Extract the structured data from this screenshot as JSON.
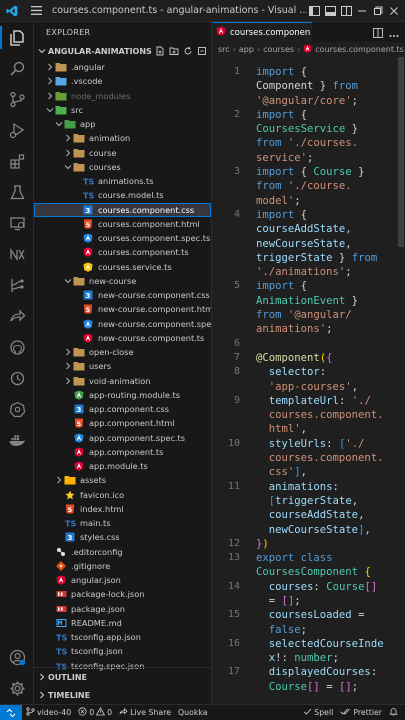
{
  "window": {
    "title": "courses.component.ts - angular-animations - Visual …"
  },
  "sidebar": {
    "header": "EXPLORER",
    "root": "ANGULAR-ANIMATIONS",
    "tree": [
      {
        "label": ".angular",
        "depth": 1,
        "kind": "folder",
        "open": false,
        "icon": "folder",
        "color": "#cccccc"
      },
      {
        "label": ".vscode",
        "depth": 1,
        "kind": "folder",
        "open": false,
        "icon": "vscode-folder",
        "color": "#cccccc"
      },
      {
        "label": "node_modules",
        "depth": 1,
        "kind": "folder",
        "open": false,
        "icon": "node-folder",
        "color": "#6b6b6b"
      },
      {
        "label": "src",
        "depth": 1,
        "kind": "folder",
        "open": true,
        "icon": "src-folder",
        "color": "#cccccc"
      },
      {
        "label": "app",
        "depth": 2,
        "kind": "folder",
        "open": true,
        "icon": "app-folder",
        "color": "#cccccc"
      },
      {
        "label": "animation",
        "depth": 3,
        "kind": "folder",
        "open": false,
        "icon": "folder",
        "color": "#cccccc"
      },
      {
        "label": "course",
        "depth": 3,
        "kind": "folder",
        "open": false,
        "icon": "folder",
        "color": "#cccccc"
      },
      {
        "label": "courses",
        "depth": 3,
        "kind": "folder",
        "open": true,
        "icon": "folder",
        "color": "#cccccc"
      },
      {
        "label": "animations.ts",
        "depth": 4,
        "kind": "file",
        "icon": "ts",
        "color": "#cccccc"
      },
      {
        "label": "course.model.ts",
        "depth": 4,
        "kind": "file",
        "icon": "ts",
        "color": "#cccccc"
      },
      {
        "label": "courses.component.css",
        "depth": 4,
        "kind": "file",
        "icon": "css",
        "color": "#ffffff",
        "selected": true
      },
      {
        "label": "courses.component.html",
        "depth": 4,
        "kind": "file",
        "icon": "html",
        "color": "#cccccc"
      },
      {
        "label": "courses.component.spec.ts",
        "depth": 4,
        "kind": "file",
        "icon": "angular-spec",
        "color": "#cccccc"
      },
      {
        "label": "courses.component.ts",
        "depth": 4,
        "kind": "file",
        "icon": "angular",
        "color": "#cccccc"
      },
      {
        "label": "courses.service.ts",
        "depth": 4,
        "kind": "file",
        "icon": "angular-service",
        "color": "#cccccc"
      },
      {
        "label": "new-course",
        "depth": 3,
        "kind": "folder",
        "open": true,
        "icon": "folder",
        "color": "#cccccc"
      },
      {
        "label": "new-course.component.css",
        "depth": 4,
        "kind": "file",
        "icon": "css",
        "color": "#cccccc"
      },
      {
        "label": "new-course.component.html",
        "depth": 4,
        "kind": "file",
        "icon": "html",
        "color": "#cccccc"
      },
      {
        "label": "new-course.component.spec.ts",
        "depth": 4,
        "kind": "file",
        "icon": "angular-spec",
        "color": "#cccccc"
      },
      {
        "label": "new-course.component.ts",
        "depth": 4,
        "kind": "file",
        "icon": "angular",
        "color": "#cccccc"
      },
      {
        "label": "open-close",
        "depth": 3,
        "kind": "folder",
        "open": false,
        "icon": "folder",
        "color": "#cccccc"
      },
      {
        "label": "users",
        "depth": 3,
        "kind": "folder",
        "open": false,
        "icon": "folder",
        "color": "#cccccc"
      },
      {
        "label": "void-animation",
        "depth": 3,
        "kind": "folder",
        "open": false,
        "icon": "folder",
        "color": "#cccccc"
      },
      {
        "label": "app-routing.module.ts",
        "depth": 3,
        "kind": "file",
        "icon": "angular-routing",
        "color": "#cccccc"
      },
      {
        "label": "app.component.css",
        "depth": 3,
        "kind": "file",
        "icon": "css",
        "color": "#cccccc"
      },
      {
        "label": "app.component.html",
        "depth": 3,
        "kind": "file",
        "icon": "html",
        "color": "#cccccc"
      },
      {
        "label": "app.component.spec.ts",
        "depth": 3,
        "kind": "file",
        "icon": "angular-spec",
        "color": "#cccccc"
      },
      {
        "label": "app.component.ts",
        "depth": 3,
        "kind": "file",
        "icon": "angular",
        "color": "#cccccc"
      },
      {
        "label": "app.module.ts",
        "depth": 3,
        "kind": "file",
        "icon": "angular",
        "color": "#cccccc"
      },
      {
        "label": "assets",
        "depth": 2,
        "kind": "folder",
        "open": false,
        "icon": "assets-folder",
        "color": "#cccccc"
      },
      {
        "label": "favicon.ico",
        "depth": 2,
        "kind": "file",
        "icon": "favicon",
        "color": "#cccccc"
      },
      {
        "label": "index.html",
        "depth": 2,
        "kind": "file",
        "icon": "html",
        "color": "#cccccc"
      },
      {
        "label": "main.ts",
        "depth": 2,
        "kind": "file",
        "icon": "ts",
        "color": "#cccccc"
      },
      {
        "label": "styles.css",
        "depth": 2,
        "kind": "file",
        "icon": "css",
        "color": "#cccccc"
      },
      {
        "label": ".editorconfig",
        "depth": 1,
        "kind": "file",
        "icon": "editorconfig",
        "color": "#cccccc"
      },
      {
        "label": ".gitignore",
        "depth": 1,
        "kind": "file",
        "icon": "git",
        "color": "#cccccc"
      },
      {
        "label": "angular.json",
        "depth": 1,
        "kind": "file",
        "icon": "angular",
        "color": "#cccccc"
      },
      {
        "label": "package-lock.json",
        "depth": 1,
        "kind": "file",
        "icon": "npm",
        "color": "#cccccc"
      },
      {
        "label": "package.json",
        "depth": 1,
        "kind": "file",
        "icon": "npm",
        "color": "#cccccc"
      },
      {
        "label": "README.md",
        "depth": 1,
        "kind": "file",
        "icon": "markdown",
        "color": "#cccccc"
      },
      {
        "label": "tsconfig.app.json",
        "depth": 1,
        "kind": "file",
        "icon": "tsconfig",
        "color": "#cccccc"
      },
      {
        "label": "tsconfig.json",
        "depth": 1,
        "kind": "file",
        "icon": "tsconfig",
        "color": "#cccccc"
      },
      {
        "label": "tsconfig.spec.json",
        "depth": 1,
        "kind": "file",
        "icon": "tsconfig",
        "color": "#cccccc"
      }
    ],
    "outline": "OUTLINE",
    "timeline": "TIMELINE"
  },
  "editor": {
    "tab_label": "courses.componen",
    "breadcrumb": [
      "src",
      "app",
      "courses",
      "courses.component.ts"
    ],
    "lines": [
      {
        "n": "1",
        "segs": [
          [
            "kw",
            "import"
          ],
          [
            "pn",
            " {"
          ]
        ]
      },
      {
        "n": "",
        "segs": [
          [
            "pn",
            "Component } "
          ],
          [
            "kw",
            "from"
          ]
        ]
      },
      {
        "n": "",
        "segs": [
          [
            "str",
            "'@angular/core'"
          ],
          [
            "pn",
            ";"
          ]
        ]
      },
      {
        "n": "2",
        "segs": [
          [
            "kw",
            "import"
          ],
          [
            "pn",
            " {"
          ]
        ]
      },
      {
        "n": "",
        "segs": [
          [
            "ty",
            "CoursesService"
          ],
          [
            "pn",
            " }"
          ]
        ]
      },
      {
        "n": "",
        "segs": [
          [
            "kw",
            "from"
          ],
          [
            "pn",
            " "
          ],
          [
            "str",
            "'./courses."
          ]
        ]
      },
      {
        "n": "",
        "segs": [
          [
            "str",
            "service'"
          ],
          [
            "pn",
            ";"
          ]
        ]
      },
      {
        "n": "3",
        "segs": [
          [
            "kw",
            "import"
          ],
          [
            "pn",
            " { "
          ],
          [
            "ty",
            "Course"
          ],
          [
            "pn",
            " }"
          ]
        ]
      },
      {
        "n": "",
        "segs": [
          [
            "kw",
            "from"
          ],
          [
            "pn",
            " "
          ],
          [
            "str",
            "'./course."
          ]
        ]
      },
      {
        "n": "",
        "segs": [
          [
            "str",
            "model'"
          ],
          [
            "pn",
            ";"
          ]
        ]
      },
      {
        "n": "4",
        "segs": [
          [
            "kw",
            "import"
          ],
          [
            "pn",
            " {"
          ]
        ]
      },
      {
        "n": "",
        "segs": [
          [
            "prop",
            "courseAddState"
          ],
          [
            "pn",
            ","
          ]
        ]
      },
      {
        "n": "",
        "segs": [
          [
            "prop",
            "newCourseState"
          ],
          [
            "pn",
            ","
          ]
        ]
      },
      {
        "n": "",
        "segs": [
          [
            "prop",
            "triggerState"
          ],
          [
            "pn",
            " } "
          ],
          [
            "kw",
            "from"
          ]
        ]
      },
      {
        "n": "",
        "segs": [
          [
            "str",
            "'./animations'"
          ],
          [
            "pn",
            ";"
          ]
        ]
      },
      {
        "n": "5",
        "segs": [
          [
            "kw",
            "import"
          ],
          [
            "pn",
            " {"
          ]
        ]
      },
      {
        "n": "",
        "segs": [
          [
            "ty",
            "AnimationEvent"
          ],
          [
            "pn",
            " }"
          ]
        ]
      },
      {
        "n": "",
        "segs": [
          [
            "kw",
            "from"
          ],
          [
            "pn",
            " "
          ],
          [
            "str",
            "'@angular/"
          ]
        ]
      },
      {
        "n": "",
        "segs": [
          [
            "str",
            "animations'"
          ],
          [
            "pn",
            ";"
          ]
        ]
      },
      {
        "n": "6",
        "segs": []
      },
      {
        "n": "7",
        "segs": [
          [
            "fn",
            "@Component"
          ],
          [
            "br1",
            "("
          ],
          [
            "br2",
            "{"
          ]
        ]
      },
      {
        "n": "8",
        "segs": [
          [
            "pn",
            "  "
          ],
          [
            "prop",
            "selector"
          ],
          [
            "pn",
            ":"
          ]
        ]
      },
      {
        "n": "",
        "segs": [
          [
            "pn",
            "  "
          ],
          [
            "str",
            "'app-courses'"
          ],
          [
            "pn",
            ","
          ]
        ]
      },
      {
        "n": "9",
        "segs": [
          [
            "pn",
            "  "
          ],
          [
            "prop",
            "templateUrl"
          ],
          [
            "pn",
            ": "
          ],
          [
            "str",
            "'./"
          ]
        ]
      },
      {
        "n": "",
        "segs": [
          [
            "pn",
            "  "
          ],
          [
            "str",
            "courses.component."
          ]
        ]
      },
      {
        "n": "",
        "segs": [
          [
            "pn",
            "  "
          ],
          [
            "str",
            "html'"
          ],
          [
            "pn",
            ","
          ]
        ]
      },
      {
        "n": "10",
        "segs": [
          [
            "pn",
            "  "
          ],
          [
            "prop",
            "styleUrls"
          ],
          [
            "pn",
            ": "
          ],
          [
            "br3",
            "["
          ],
          [
            "str",
            "'./"
          ]
        ]
      },
      {
        "n": "",
        "segs": [
          [
            "pn",
            "  "
          ],
          [
            "str",
            "courses.component."
          ]
        ]
      },
      {
        "n": "",
        "segs": [
          [
            "pn",
            "  "
          ],
          [
            "str",
            "css'"
          ],
          [
            "br3",
            "]"
          ],
          [
            "pn",
            ","
          ]
        ]
      },
      {
        "n": "11",
        "segs": [
          [
            "pn",
            "  "
          ],
          [
            "prop",
            "animations"
          ],
          [
            "pn",
            ":"
          ]
        ]
      },
      {
        "n": "",
        "segs": [
          [
            "pn",
            "  "
          ],
          [
            "br3",
            "["
          ],
          [
            "prop",
            "triggerState"
          ],
          [
            "pn",
            ","
          ]
        ]
      },
      {
        "n": "",
        "segs": [
          [
            "pn",
            "  "
          ],
          [
            "prop",
            "courseAddState"
          ],
          [
            "pn",
            ","
          ]
        ]
      },
      {
        "n": "",
        "segs": [
          [
            "pn",
            "  "
          ],
          [
            "prop",
            "newCourseState"
          ],
          [
            "br3",
            "]"
          ],
          [
            "pn",
            ","
          ]
        ]
      },
      {
        "n": "12",
        "segs": [
          [
            "br2",
            "}"
          ],
          [
            "br1",
            ")"
          ]
        ]
      },
      {
        "n": "13",
        "segs": [
          [
            "kw",
            "export"
          ],
          [
            "pn",
            " "
          ],
          [
            "kw",
            "class"
          ]
        ]
      },
      {
        "n": "",
        "segs": [
          [
            "ty",
            "CoursesComponent"
          ],
          [
            "pn",
            " "
          ],
          [
            "br1",
            "{"
          ]
        ]
      },
      {
        "n": "14",
        "segs": [
          [
            "pn",
            "  "
          ],
          [
            "prop",
            "courses"
          ],
          [
            "pn",
            ": "
          ],
          [
            "ty",
            "Course"
          ],
          [
            "br2",
            "[]"
          ]
        ]
      },
      {
        "n": "",
        "segs": [
          [
            "pn",
            "  = "
          ],
          [
            "br2",
            "[]"
          ],
          [
            "pn",
            ";"
          ]
        ]
      },
      {
        "n": "15",
        "segs": [
          [
            "pn",
            "  "
          ],
          [
            "prop",
            "coursesLoaded"
          ],
          [
            "pn",
            " ="
          ]
        ]
      },
      {
        "n": "",
        "segs": [
          [
            "pn",
            "  "
          ],
          [
            "kw",
            "false"
          ],
          [
            "pn",
            ";"
          ]
        ]
      },
      {
        "n": "16",
        "segs": [
          [
            "pn",
            "  "
          ],
          [
            "prop",
            "selectedCourseInde"
          ]
        ]
      },
      {
        "n": "",
        "segs": [
          [
            "pn",
            "  "
          ],
          [
            "prop",
            "x"
          ],
          [
            "pn",
            "!: "
          ],
          [
            "ty",
            "number"
          ],
          [
            "pn",
            ";"
          ]
        ]
      },
      {
        "n": "17",
        "segs": [
          [
            "pn",
            "  "
          ],
          [
            "prop",
            "displayedCourses"
          ],
          [
            "pn",
            ":"
          ]
        ]
      },
      {
        "n": "",
        "segs": [
          [
            "pn",
            "  "
          ],
          [
            "ty",
            "Course"
          ],
          [
            "br2",
            "[]"
          ],
          [
            "pn",
            " = "
          ],
          [
            "br2",
            "[]"
          ],
          [
            "pn",
            ";"
          ]
        ]
      }
    ]
  },
  "status": {
    "errors": "0",
    "warnings": "0",
    "branch": "video-40",
    "live_share": "Live Share",
    "quokka": "Quokka",
    "spell": "Spell",
    "prettier": "Prettier"
  }
}
